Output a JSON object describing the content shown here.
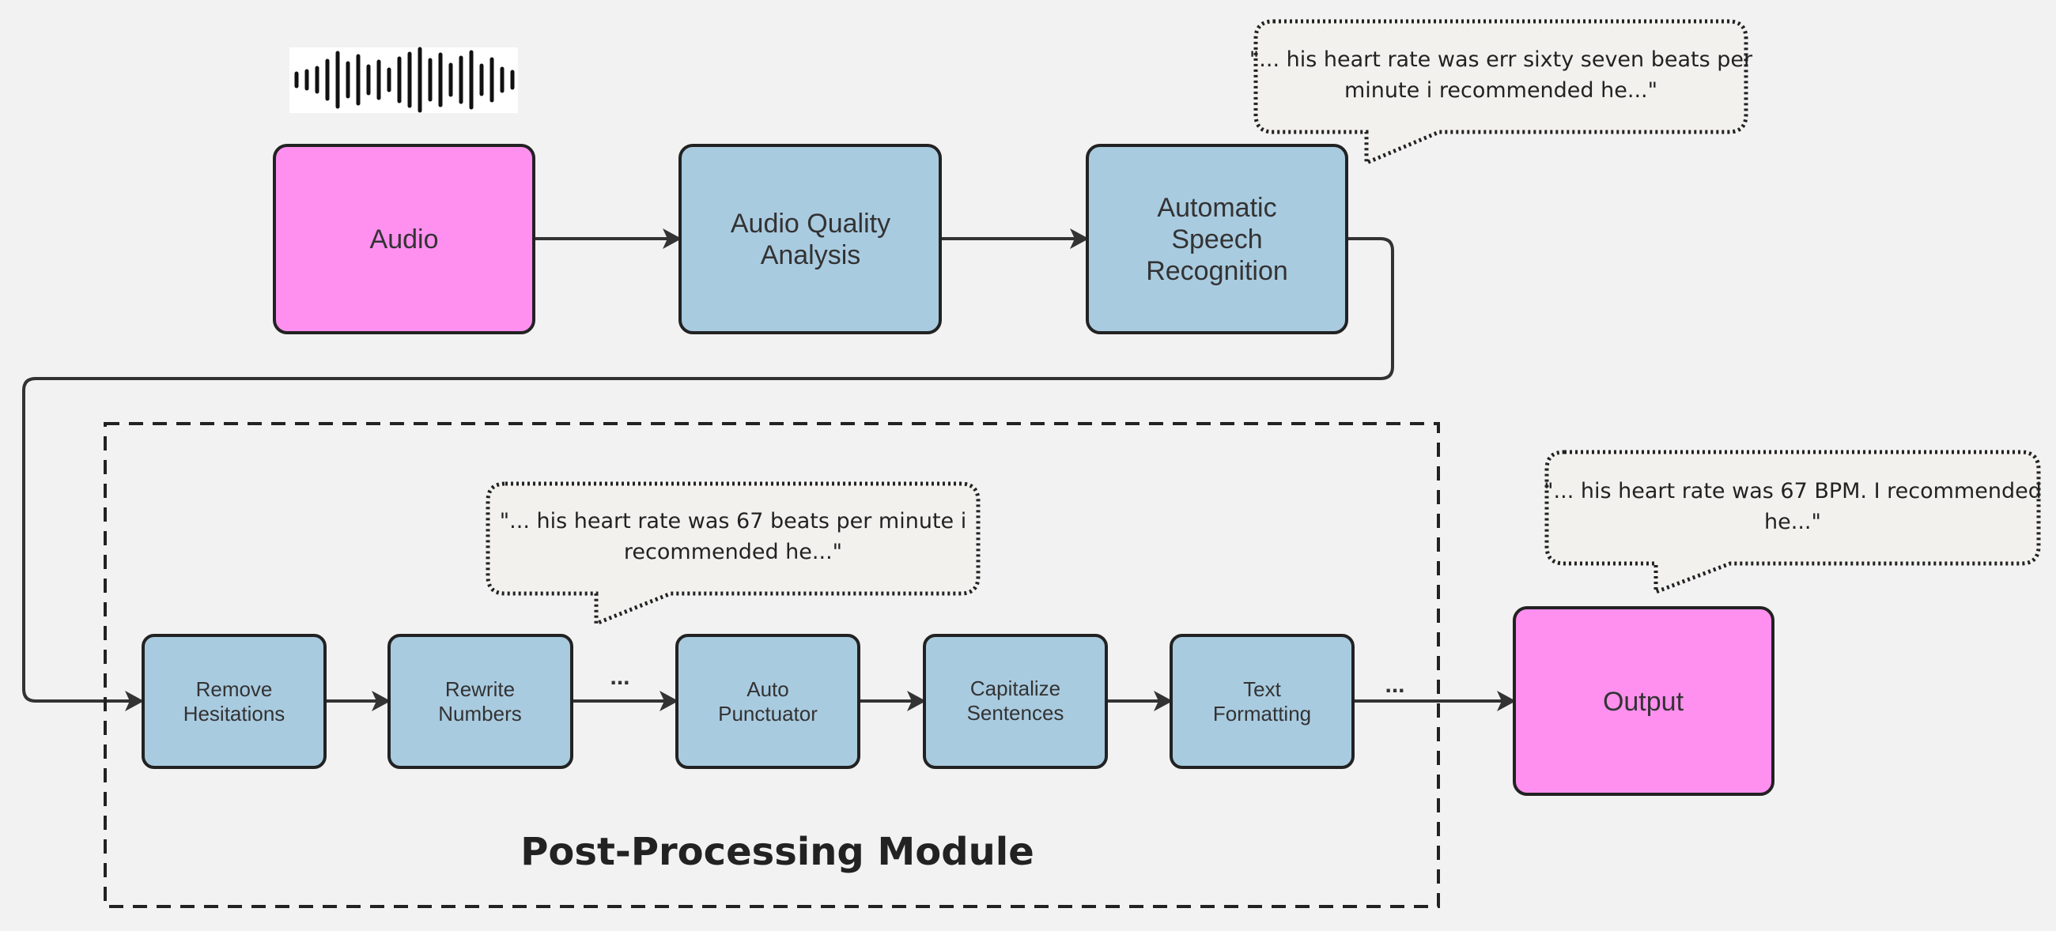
{
  "colors": {
    "io_box": "#ff90f0",
    "process_box": "#a9cbe0",
    "background": "#f2f2f2",
    "callout": "#f3f1ee"
  },
  "waveform_icon": "audio-waveform-icon",
  "nodes": {
    "audio": [
      "Audio"
    ],
    "audio_quality": [
      "Audio Quality",
      "Analysis"
    ],
    "asr": [
      "Automatic",
      "Speech",
      "Recognition"
    ],
    "remove_hesitations": [
      "Remove",
      "Hesitations"
    ],
    "rewrite_numbers": [
      "Rewrite",
      "Numbers"
    ],
    "auto_punctuator": [
      "Auto",
      "Punctuator"
    ],
    "capitalize_sentences": [
      "Capitalize",
      "Sentences"
    ],
    "text_formatting": [
      "Text",
      "Formatting"
    ],
    "output": [
      "Output"
    ]
  },
  "ellipses": [
    "...",
    "..."
  ],
  "module_title": "Post-Processing Module",
  "callouts": {
    "asr_output": [
      "\"... his heart rate was err sixty seven beats per",
      "minute i recommended he...\""
    ],
    "intermediate": [
      "\"... his heart rate was 67 beats per minute i",
      "recommended he...\""
    ],
    "final_output": [
      "\"... his heart rate was 67 BPM. I recommended",
      "he...\""
    ]
  }
}
